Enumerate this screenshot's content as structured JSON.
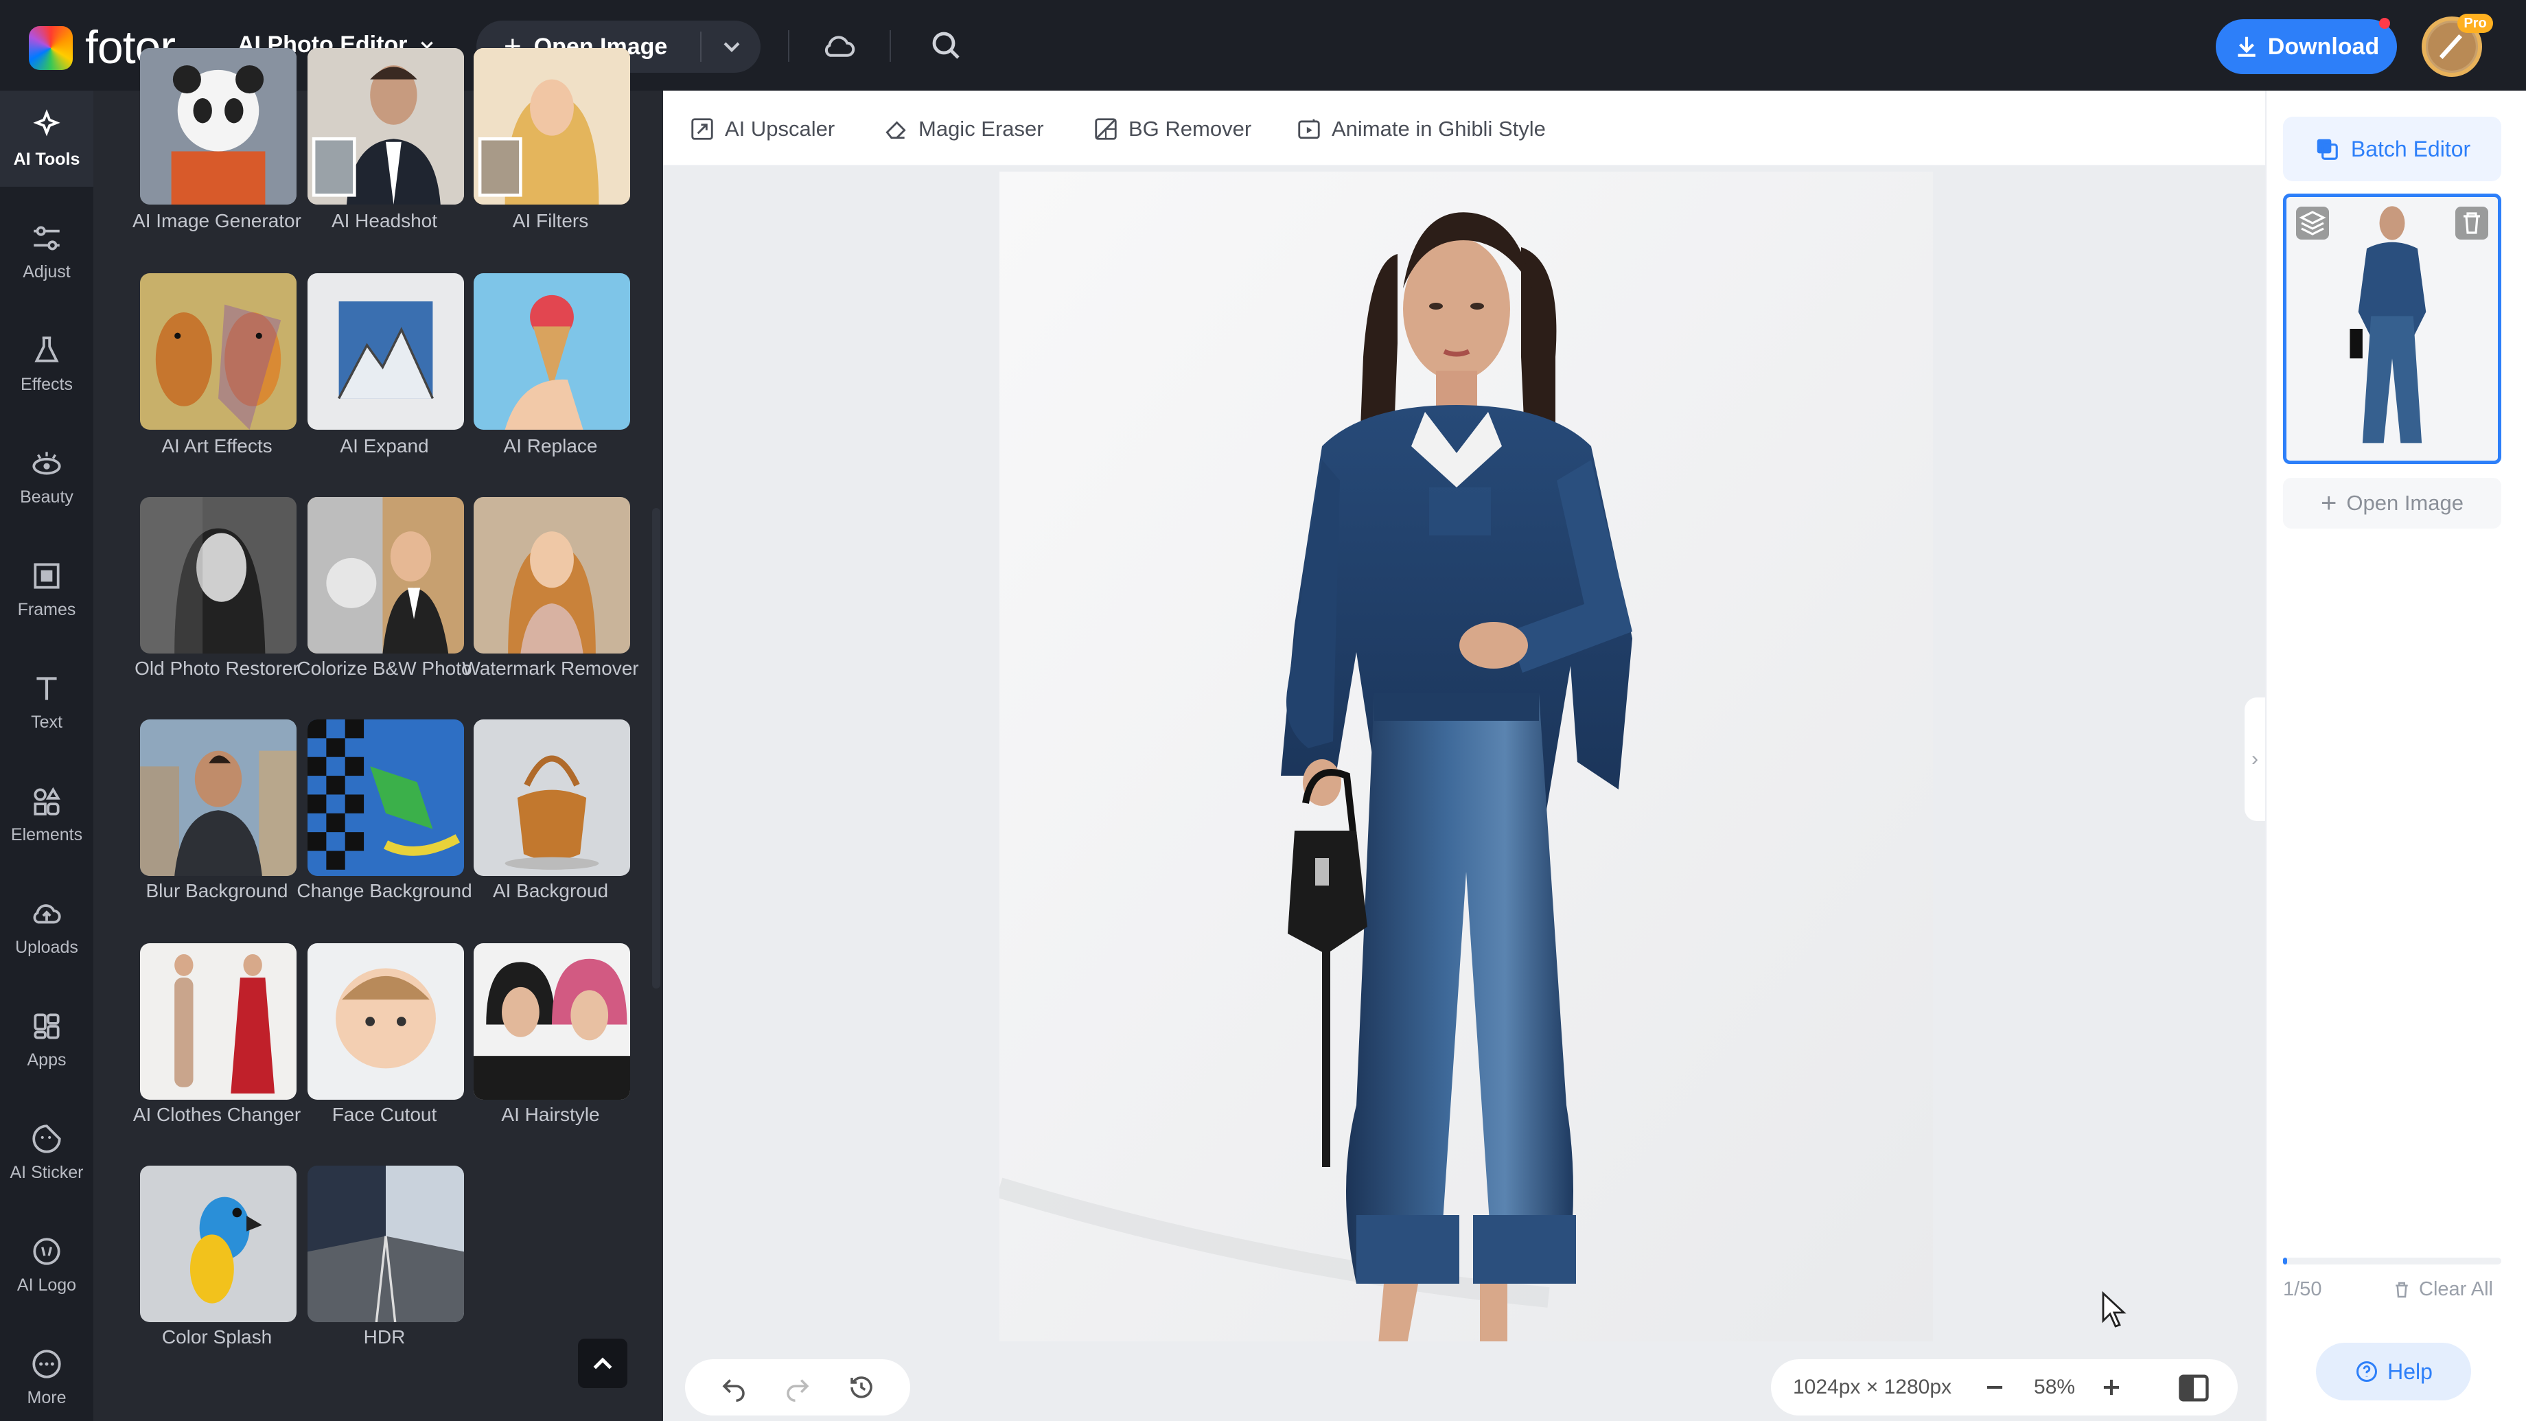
{
  "topbar": {
    "logo": "fotor",
    "menu_label": "AI Photo Editor",
    "open_image_label": "Open Image",
    "download_label": "Download",
    "pro_badge": "Pro"
  },
  "rail": {
    "items": [
      {
        "label": "AI Tools",
        "icon": "ai-tools-icon",
        "active": true
      },
      {
        "label": "Adjust",
        "icon": "sliders-icon"
      },
      {
        "label": "Effects",
        "icon": "flask-icon"
      },
      {
        "label": "Beauty",
        "icon": "eye-icon"
      },
      {
        "label": "Frames",
        "icon": "frame-icon"
      },
      {
        "label": "Text",
        "icon": "text-icon"
      },
      {
        "label": "Elements",
        "icon": "shapes-icon"
      },
      {
        "label": "Uploads",
        "icon": "cloud-upload-icon"
      },
      {
        "label": "Apps",
        "icon": "apps-icon"
      },
      {
        "label": "AI Sticker",
        "icon": "sticker-icon"
      },
      {
        "label": "AI Logo",
        "icon": "logo-icon"
      },
      {
        "label": "More",
        "icon": "more-icon"
      }
    ]
  },
  "tools": [
    {
      "label": "AI Image Generator",
      "thumb": "panda"
    },
    {
      "label": "AI Headshot",
      "thumb": "headshot"
    },
    {
      "label": "AI Filters",
      "thumb": "filters"
    },
    {
      "label": "AI Art Effects",
      "thumb": "dogs"
    },
    {
      "label": "AI Expand",
      "thumb": "mountain"
    },
    {
      "label": "AI Replace",
      "thumb": "icecream"
    },
    {
      "label": "Old Photo Restorer",
      "thumb": "oldphoto"
    },
    {
      "label": "Colorize B&W Photo",
      "thumb": "colorize"
    },
    {
      "label": "Watermark Remover",
      "thumb": "watermark"
    },
    {
      "label": "Blur Background",
      "thumb": "blur"
    },
    {
      "label": "Change Background",
      "thumb": "change"
    },
    {
      "label": "AI Backgroud",
      "thumb": "bag"
    },
    {
      "label": "AI Clothes Changer",
      "thumb": "clothes"
    },
    {
      "label": "Face Cutout",
      "thumb": "baby"
    },
    {
      "label": "AI Hairstyle",
      "thumb": "hair"
    },
    {
      "label": "Color Splash",
      "thumb": "parrot"
    },
    {
      "label": "HDR",
      "thumb": "road"
    }
  ],
  "toolbar": {
    "items": [
      {
        "label": "AI Upscaler",
        "icon": "upscale-icon"
      },
      {
        "label": "Magic Eraser",
        "icon": "eraser-icon"
      },
      {
        "label": "BG Remover",
        "icon": "bg-remover-icon"
      },
      {
        "label": "Animate in Ghibli Style",
        "icon": "animate-icon"
      }
    ]
  },
  "canvas": {
    "dimensions": "1024px × 1280px",
    "zoom": "58%"
  },
  "right_panel": {
    "batch_editor_label": "Batch Editor",
    "open_image_label": "Open Image",
    "count": "1/50",
    "clear_all_label": "Clear All",
    "help_label": "Help",
    "progress_fraction": 0.02
  },
  "colors": {
    "accent": "#2d7ff9",
    "topbar_bg": "#1c1f26",
    "panel_bg": "#262930"
  }
}
